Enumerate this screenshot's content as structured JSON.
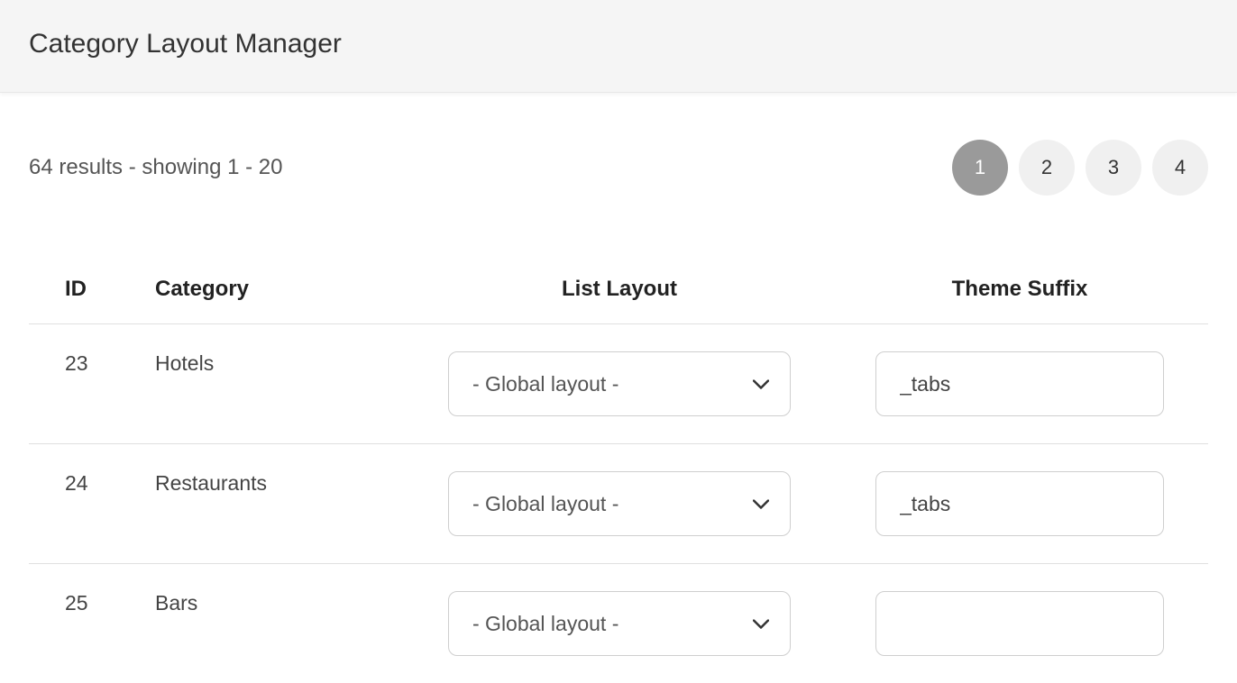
{
  "header": {
    "title": "Category Layout Manager"
  },
  "results": {
    "text": "64 results - showing 1 - 20"
  },
  "pagination": {
    "pages": [
      "1",
      "2",
      "3",
      "4"
    ],
    "active": "1"
  },
  "table": {
    "headers": {
      "id": "ID",
      "category": "Category",
      "list_layout": "List Layout",
      "theme_suffix": "Theme Suffix"
    },
    "rows": [
      {
        "id": "23",
        "category": "Hotels",
        "list_layout": "- Global layout -",
        "theme_suffix": "_tabs"
      },
      {
        "id": "24",
        "category": "Restaurants",
        "list_layout": "- Global layout -",
        "theme_suffix": "_tabs"
      },
      {
        "id": "25",
        "category": "Bars",
        "list_layout": "- Global layout -",
        "theme_suffix": ""
      }
    ]
  }
}
